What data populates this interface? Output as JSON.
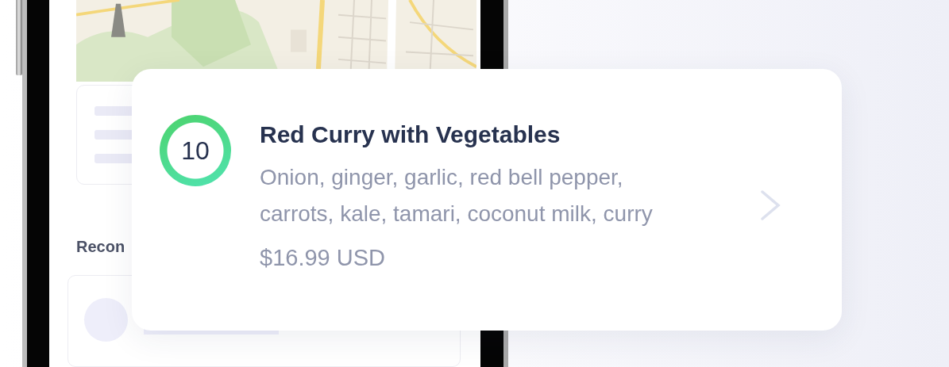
{
  "phone_screen": {
    "section_heading": "Recon"
  },
  "dish_card": {
    "score": "10",
    "title": "Red Curry with Vegetables",
    "ingredients": "Onion, ginger, garlic, red bell pepper, carrots, kale, tamari, coconut milk, curry",
    "price": "$16.99 USD"
  }
}
